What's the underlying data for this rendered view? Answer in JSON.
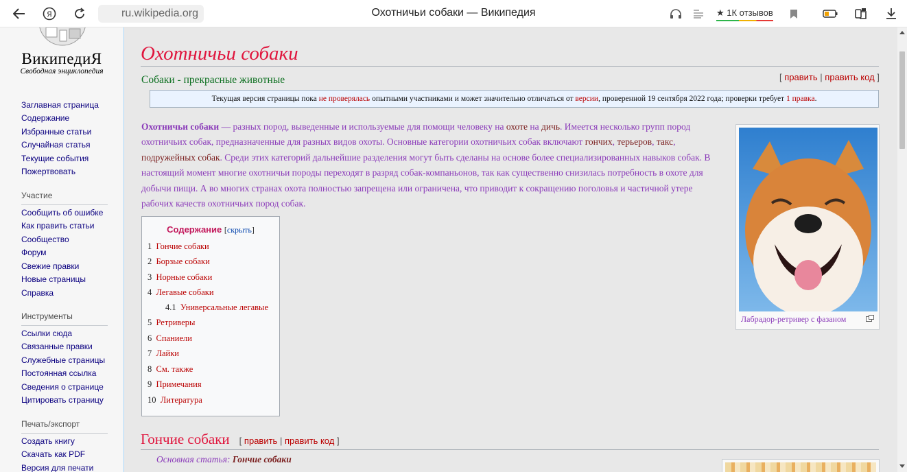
{
  "browser": {
    "address": "ru.wikipedia.org",
    "tab_title": "Охотничьи собаки — Википедия",
    "reviews": "★ 1К отзывов"
  },
  "sidebar": {
    "logo_word": "ВикипедиЯ",
    "logo_tagline": "Свободная энциклопедия",
    "main_links": [
      "Заглавная страница",
      "Содержание",
      "Избранные статьи",
      "Случайная статья",
      "Текущие события",
      "Пожертвовать"
    ],
    "participation": {
      "heading": "Участие",
      "links": [
        "Сообщить об ошибке",
        "Как править статьи",
        "Сообщество",
        "Форум",
        "Свежие правки",
        "Новые страницы",
        "Справка"
      ]
    },
    "tools": {
      "heading": "Инструменты",
      "links": [
        "Ссылки сюда",
        "Связанные правки",
        "Служебные страницы",
        "Постоянная ссылка",
        "Сведения о странице",
        "Цитировать страницу"
      ]
    },
    "export": {
      "heading": "Печать/экспорт",
      "links": [
        "Создать книгу",
        "Скачать как PDF",
        "Версия для печати"
      ]
    }
  },
  "article": {
    "title": "Охотничьи собаки",
    "subtitle": "Собаки - прекрасные животные",
    "edit": {
      "open": "[",
      "edit": "править",
      "sep": "|",
      "edit_code": "править код",
      "close": "]"
    },
    "notice": {
      "p1": "Текущая версия страницы пока ",
      "l1": "не проверялась",
      "p2": " опытными участниками и может значительно отличаться от ",
      "l2": "версии",
      "p3": ", проверенной 19 сентября 2022 года; проверки требует ",
      "l3": "1 правка",
      "p4": "."
    },
    "lead": {
      "term": "Охотничьи собаки",
      "t1": " — разных пород, выведенные и используемые для помощи человеку на ",
      "l_hunt": "охоте",
      "t2": " на ",
      "l_game": "дичь",
      "t3": ". Имеется несколько групп пород охотничьих собак, предназначенные для разных видов охоты. Основные категории охотничьих собак включают ",
      "l_hounds": "гончих",
      "t4": ", ",
      "l_terriers": "терьеров",
      "t5": ", ",
      "l_dachs": "такс",
      "t6": ", ",
      "l_pointing": "подружейных собак",
      "t7": ". Среди этих категорий дальнейшие разделения могут быть сделаны на основе более специализированных навыков собак. В настоящий момент многие охотничьи породы переходят в разряд собак-компаньонов, так как существенно снизилась потребность в охоте для добычи пищи. А во многих странах охота полностью запрещена или ограничена, что приводит к сокращению поголовья и частичной утере рабочих качеств охотничьих пород собак."
    },
    "image_caption": "Лабрадор-ретривер с фазаном",
    "toc": {
      "title": "Содержание",
      "hide_open": "[",
      "hide": "скрыть",
      "hide_close": "]",
      "items": [
        {
          "num": "1",
          "text": "Гончие собаки"
        },
        {
          "num": "2",
          "text": "Борзые собаки"
        },
        {
          "num": "3",
          "text": "Норные собаки"
        },
        {
          "num": "4",
          "text": "Легавые собаки"
        },
        {
          "num": "4.1",
          "text": "Универсальные легавые"
        },
        {
          "num": "5",
          "text": "Ретриверы"
        },
        {
          "num": "6",
          "text": "Спаниели"
        },
        {
          "num": "7",
          "text": "Лайки"
        },
        {
          "num": "8",
          "text": "См. также"
        },
        {
          "num": "9",
          "text": "Примечания"
        },
        {
          "num": "10",
          "text": "Литература"
        }
      ]
    },
    "section1": {
      "title": "Гончие собаки",
      "main_prefix": "Основная статья: ",
      "main_link": "Гончие собаки"
    }
  },
  "colors": {
    "title": "#e0153d",
    "link_red": "#ba0000",
    "text_purple": "#8a3ab9",
    "notice_bg": "#eaf3ff"
  }
}
